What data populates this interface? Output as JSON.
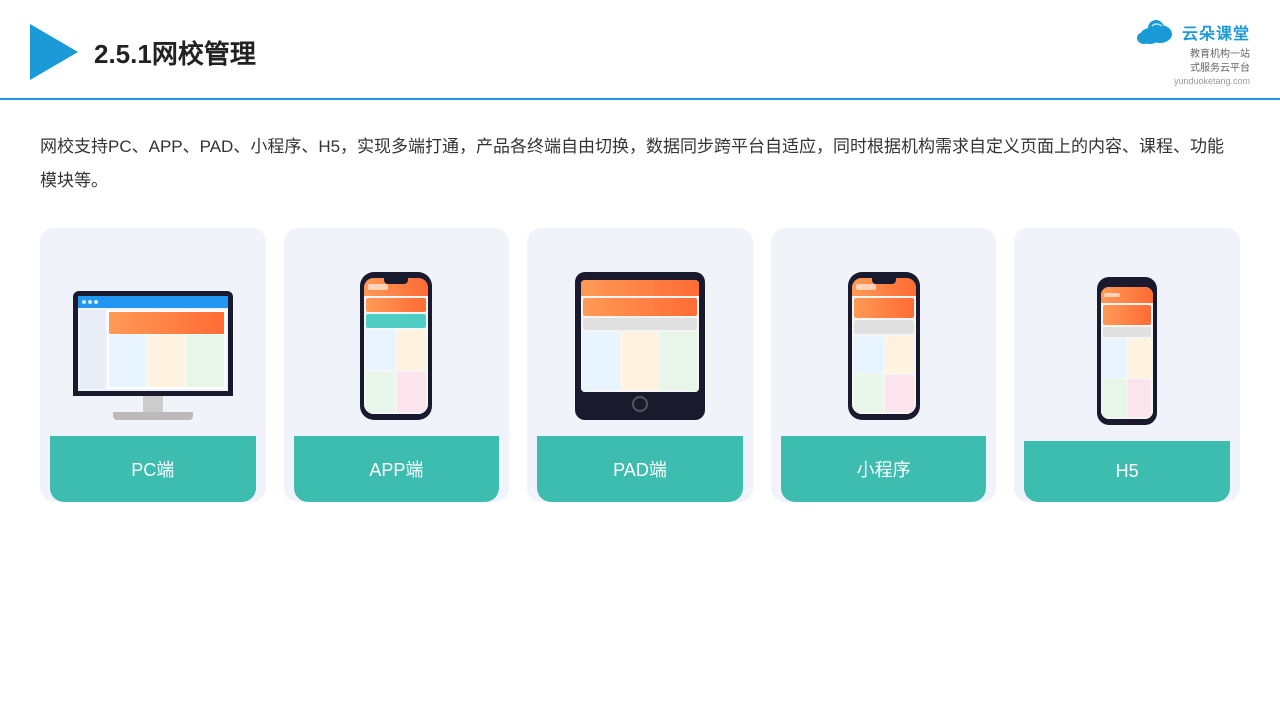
{
  "header": {
    "title": "2.5.1网校管理",
    "brand_name": "云朵课堂",
    "brand_url": "yunduoketang.com",
    "brand_subtitle_line1": "教育机构一站",
    "brand_subtitle_line2": "式服务云平台"
  },
  "description": "网校支持PC、APP、PAD、小程序、H5，实现多端打通，产品各终端自由切换，数据同步跨平台自适应，同时根据机构需求自定义页面上的内容、课程、功能模块等。",
  "devices": [
    {
      "label": "PC端",
      "type": "desktop"
    },
    {
      "label": "APP端",
      "type": "phone"
    },
    {
      "label": "PAD端",
      "type": "tablet"
    },
    {
      "label": "小程序",
      "type": "phone_notch"
    },
    {
      "label": "H5",
      "type": "phone_mini"
    }
  ]
}
